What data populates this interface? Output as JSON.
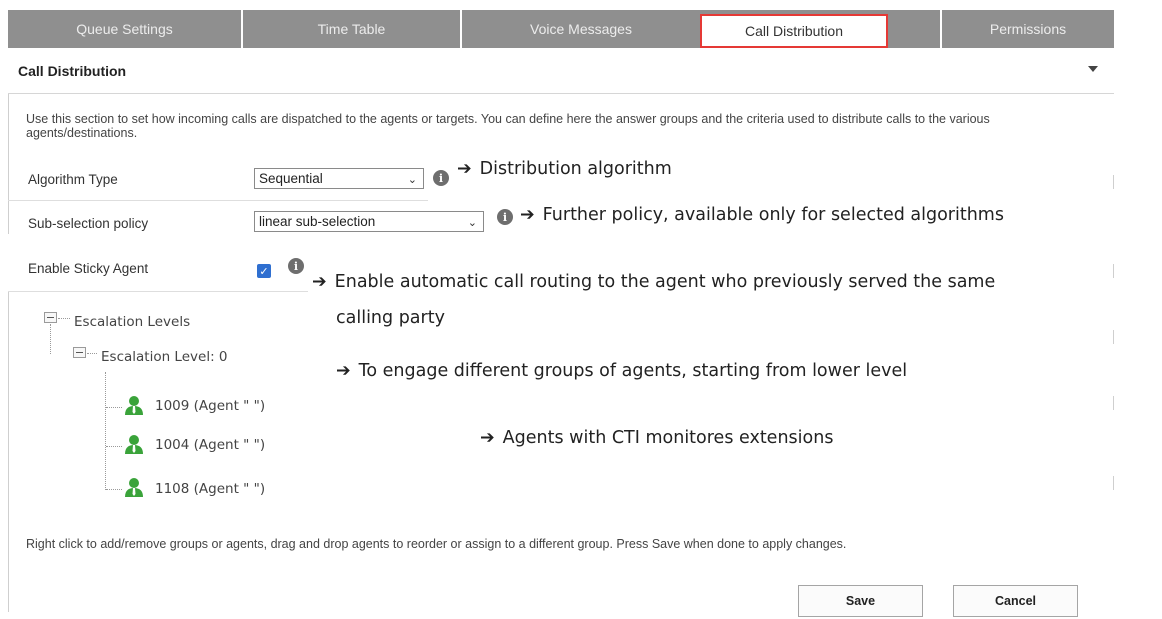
{
  "tabs": [
    {
      "label": "Queue Settings"
    },
    {
      "label": "Time Table"
    },
    {
      "label": "Voice Messages"
    },
    {
      "label": "Call Distribution"
    },
    {
      "label": "Permissions"
    }
  ],
  "panel": {
    "title": "Call Distribution",
    "description": "Use this section to set how incoming calls are dispatched to the agents or targets. You can define here the answer groups and the criteria used to distribute calls to the various agents/destinations."
  },
  "fields": {
    "algorithm": {
      "label": "Algorithm Type",
      "value": "Sequential"
    },
    "subselection": {
      "label": "Sub-selection policy",
      "value": "linear sub-selection"
    },
    "sticky": {
      "label": "Enable Sticky Agent",
      "checked": true
    }
  },
  "icons": {
    "info": "info-icon",
    "expand": "tree-collapse-icon",
    "agent": "agent-icon",
    "arrow": "right-arrow-icon"
  },
  "tree": {
    "root": "Escalation Levels",
    "level": "Escalation Level: 0",
    "agents": [
      "1009 (Agent \" \")",
      "1004 (Agent \" \")",
      "1108 (Agent \" \")"
    ]
  },
  "annotations": {
    "arrow": "➔",
    "algorithm": "Distribution algorithm",
    "subselection": "Further policy, available only for selected algorithms",
    "sticky_line1": "Enable automatic call routing to the agent who previously served the same",
    "sticky_line2": "calling party",
    "escalation": "To engage different groups of agents, starting from lower level",
    "agents": "Agents with CTI monitores extensions"
  },
  "footer": {
    "hint": "Right click to add/remove groups or agents, drag and drop agents to reorder or assign to a different group. Press Save when done to apply changes.",
    "save": "Save",
    "cancel": "Cancel"
  },
  "colors": {
    "tab_bg": "#8f8f8f",
    "active_tab_outline": "#e53935",
    "checkbox": "#2f6fd0",
    "agent_green": "#3aa33a"
  }
}
